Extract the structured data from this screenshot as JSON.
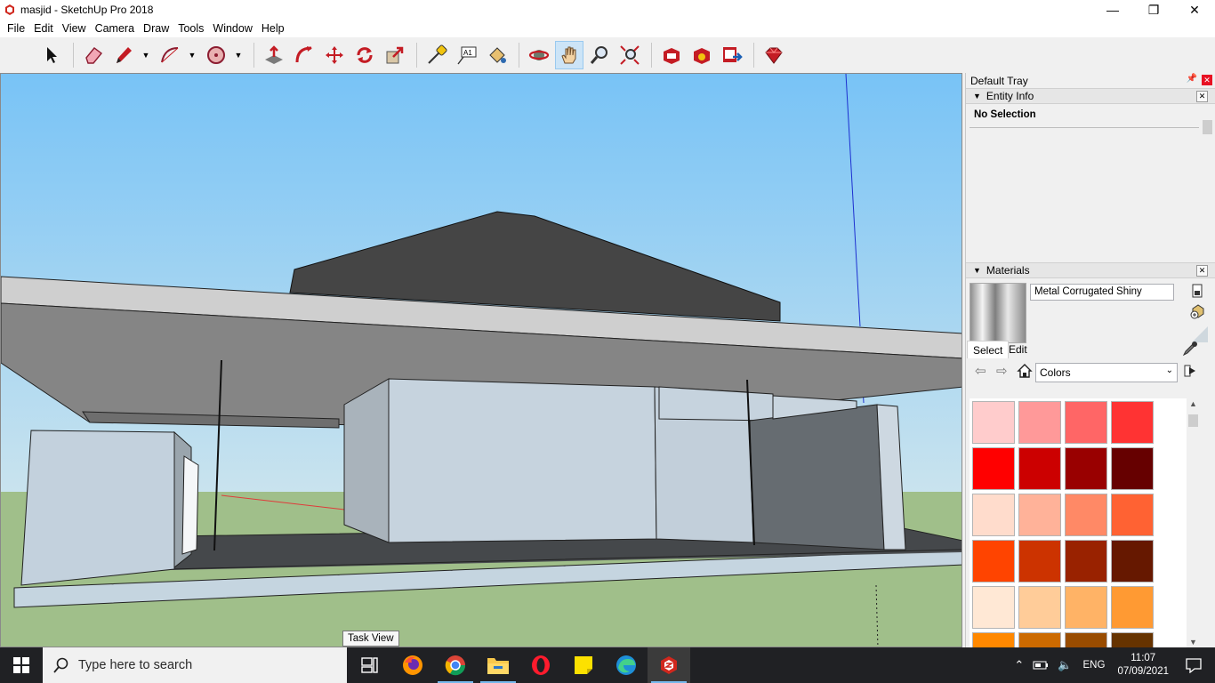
{
  "window": {
    "title": "masjid - SketchUp Pro 2018"
  },
  "menu": [
    "File",
    "Edit",
    "View",
    "Camera",
    "Draw",
    "Tools",
    "Window",
    "Help"
  ],
  "toolbar": {
    "tools": [
      "select-icon",
      "eraser-icon",
      "pencil-icon",
      "arc-icon",
      "shape-icon",
      "push-pull-icon",
      "follow-me-icon",
      "move-icon",
      "rotate-icon",
      "scale-icon",
      "tape-measure-icon",
      "text-icon",
      "paint-bucket-icon",
      "orbit-icon",
      "pan-icon",
      "zoom-icon",
      "zoom-extents-icon",
      "warehouse-icon",
      "extension-warehouse-icon",
      "share-model-icon",
      "ruby-icon"
    ],
    "active_tool": "pan-icon",
    "text_tool_label": "A1"
  },
  "tray": {
    "title": "Default Tray",
    "entity_info": {
      "heading": "Entity Info",
      "status": "No Selection"
    },
    "materials": {
      "heading": "Materials",
      "current_material": "Metal Corrugated Shiny",
      "tabs": [
        "Select",
        "Edit"
      ],
      "active_tab": "Select",
      "collection": "Colors",
      "swatches": [
        [
          "#ffcccc",
          "#ff9999",
          "#ff6666",
          "#ff3333"
        ],
        [
          "#ff0000",
          "#cc0000",
          "#990000",
          "#660000"
        ],
        [
          "#ffdccc",
          "#ffb299",
          "#ff8966",
          "#ff6233"
        ],
        [
          "#ff4400",
          "#cc3300",
          "#992200",
          "#661800"
        ],
        [
          "#ffe8d5",
          "#ffcc99",
          "#ffb366",
          "#ff9a33"
        ],
        [
          "#ff8800",
          "#cc6a00",
          "#994c00",
          "#663300"
        ]
      ]
    }
  },
  "viewport": {
    "tooltip": "Task View"
  },
  "taskbar": {
    "search_placeholder": "Type here to search",
    "apps": [
      "task-view-icon",
      "firefox-icon",
      "chrome-icon",
      "file-explorer-icon",
      "opera-icon",
      "sticky-notes-icon",
      "edge-icon",
      "sketchup-icon"
    ],
    "language": "ENG",
    "time": "11:07",
    "date": "07/09/2021"
  }
}
